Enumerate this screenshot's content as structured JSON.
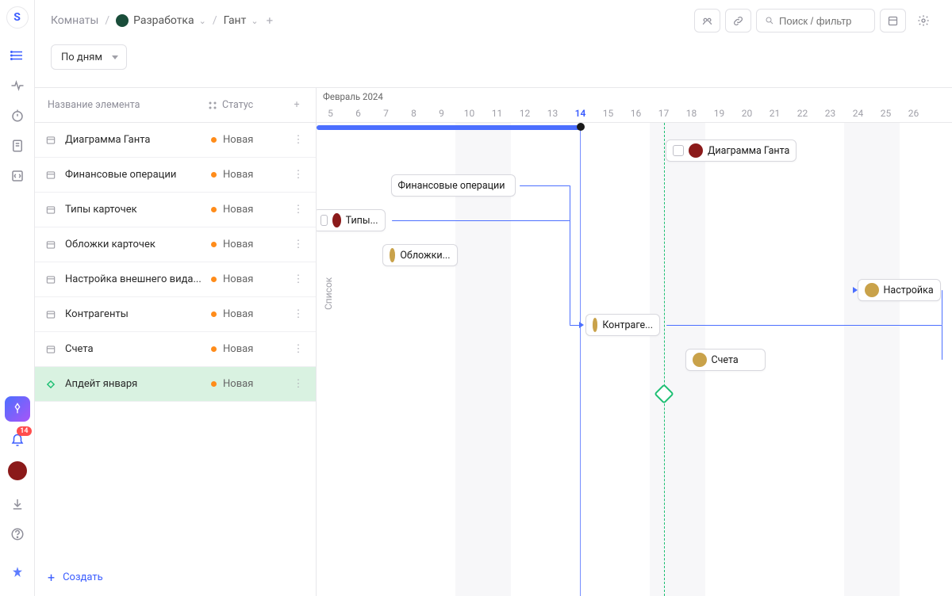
{
  "breadcrumb": {
    "rooms": "Комнаты",
    "project": "Разработка",
    "view": "Гант"
  },
  "search": {
    "placeholder": "Поиск / фильтр"
  },
  "scale_select": {
    "value": "По дням"
  },
  "list": {
    "header_name": "Название элемента",
    "header_status": "Статус",
    "create": "Создать",
    "rows": [
      {
        "name": "Диаграмма Ганта",
        "status": "Новая",
        "icon": "card"
      },
      {
        "name": "Финансовые операции",
        "status": "Новая",
        "icon": "card"
      },
      {
        "name": "Типы карточек",
        "status": "Новая",
        "icon": "card"
      },
      {
        "name": "Обложки карточек",
        "status": "Новая",
        "icon": "card"
      },
      {
        "name": "Настройка внешнего вида...",
        "status": "Новая",
        "icon": "card"
      },
      {
        "name": "Контрагенты",
        "status": "Новая",
        "icon": "card"
      },
      {
        "name": "Счета",
        "status": "Новая",
        "icon": "card"
      },
      {
        "name": "Апдейт января",
        "status": "Новая",
        "icon": "diamond",
        "selected": true
      }
    ]
  },
  "gantt": {
    "side_label": "Список",
    "month": "Февраль 2024",
    "days": [
      5,
      6,
      7,
      8,
      9,
      10,
      11,
      12,
      13,
      14,
      15,
      16,
      17,
      18,
      19,
      20,
      21,
      22,
      23,
      24,
      25,
      26
    ],
    "today": 14,
    "weekends": [
      10,
      11,
      17,
      18,
      24,
      25
    ],
    "tasks": {
      "0": {
        "label": "Диаграмма Ганта",
        "av": "#8b1a1a",
        "chk": true
      },
      "1": {
        "label": "Финансовые операции"
      },
      "2": {
        "label": "Типы...",
        "av": "#8b1a1a",
        "chk": true
      },
      "3": {
        "label": "Обложки...",
        "av": "#c9a24a"
      },
      "4": {
        "label": "Настройка",
        "av": "#c9a24a"
      },
      "5": {
        "label": "Контраге...",
        "av": "#c9a24a"
      },
      "6": {
        "label": "Счета",
        "av": "#c9a24a"
      }
    }
  },
  "notifications": {
    "count": "14"
  }
}
